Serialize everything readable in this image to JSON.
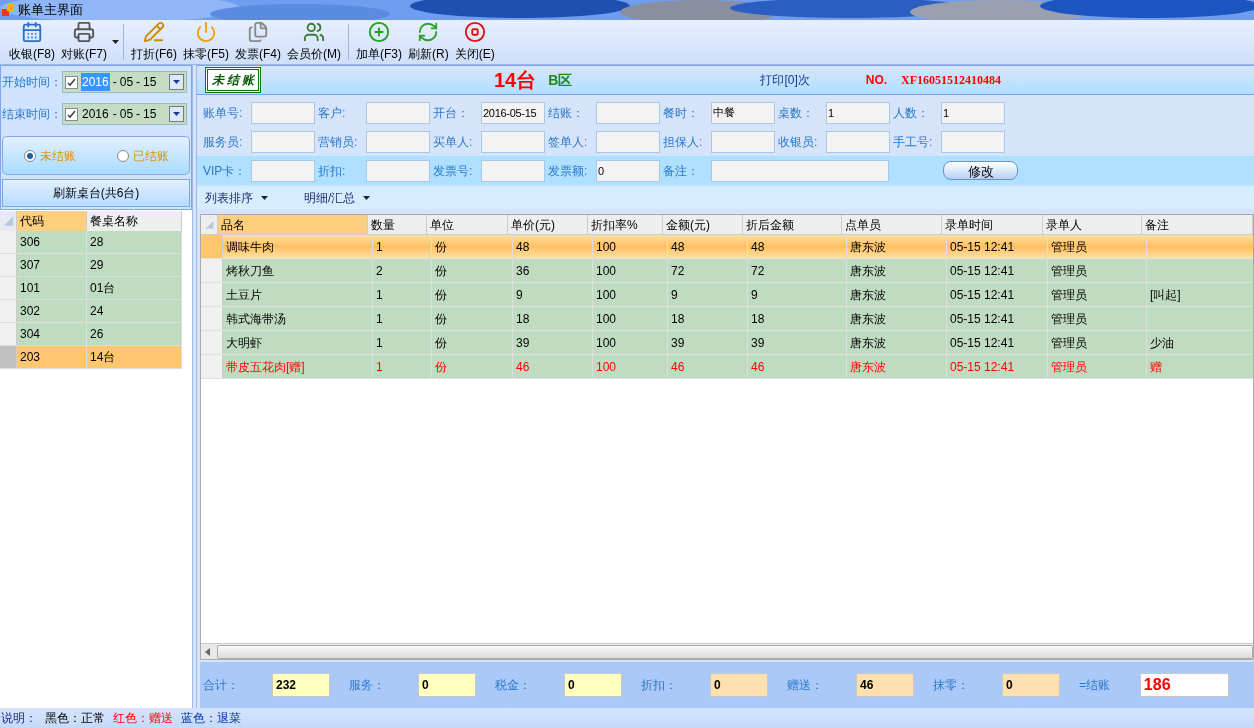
{
  "window": {
    "title": "账单主界面"
  },
  "toolbar": [
    [
      {
        "label": "收银(F8)"
      },
      {
        "label": "对账(F7)",
        "has_menu": true
      }
    ],
    [
      {
        "label": "打折(F6)"
      },
      {
        "label": "抹零(F5)"
      },
      {
        "label": "发票(F4)"
      },
      {
        "label": "会员价(M)"
      }
    ],
    [
      {
        "label": "加单(F3)"
      },
      {
        "label": "刷新(R)"
      },
      {
        "label": "关闭(E)"
      }
    ]
  ],
  "filters": [
    {
      "label": "开始时间：",
      "checked": true,
      "year": "2016",
      "month": "05",
      "day": "15",
      "sep": "-",
      "focused": true
    },
    {
      "label": "结束时间：",
      "checked": true,
      "year": "2016",
      "month": "05",
      "day": "15",
      "sep": "-",
      "focused": false
    }
  ],
  "status_radios": [
    {
      "label": "未结账",
      "selected": true
    },
    {
      "label": "已结账",
      "selected": false
    }
  ],
  "refresh_button": "刷新桌台(共6台)",
  "tables": {
    "columns": [
      "代码",
      "餐桌名称"
    ],
    "rows": [
      {
        "cells": [
          "306",
          "28"
        ],
        "selected": false
      },
      {
        "cells": [
          "307",
          "29"
        ],
        "selected": false
      },
      {
        "cells": [
          "101",
          "01台"
        ],
        "selected": false
      },
      {
        "cells": [
          "302",
          "24"
        ],
        "selected": false
      },
      {
        "cells": [
          "304",
          "26"
        ],
        "selected": false
      },
      {
        "cells": [
          "203",
          "14台"
        ],
        "selected": true
      }
    ]
  },
  "bill_header": {
    "stamp": "未 结 账",
    "table": "14台",
    "area": "B区",
    "print_count": "打印[0]次",
    "no_label": "NO.",
    "bill_no": "XF16051512410484"
  },
  "form_rows": [
    [
      {
        "label": "账单号:"
      },
      {
        "label": "客户:"
      },
      {
        "label": "开台：",
        "value": "2016-05-15"
      },
      {
        "label": "结账："
      },
      {
        "label": "餐时：",
        "value": "中餐"
      },
      {
        "label": "桌数：",
        "value": "1"
      },
      {
        "label": "人数：",
        "value": "1"
      }
    ],
    [
      {
        "label": "服务员:"
      },
      {
        "label": "营销员:"
      },
      {
        "label": "买单人:"
      },
      {
        "label": "签单人:"
      },
      {
        "label": "担保人:"
      },
      {
        "label": "收银员:"
      },
      {
        "label": "手工号:"
      }
    ],
    [
      {
        "label": "VIP卡："
      },
      {
        "label": "折扣:"
      },
      {
        "label": "发票号:"
      },
      {
        "label": "发票额:",
        "value": "0"
      },
      {
        "label": "备注：",
        "wide": true
      }
    ]
  ],
  "edit_button": "修改",
  "menus": [
    {
      "label": "列表排序"
    },
    {
      "label": "明细/汇总"
    }
  ],
  "items": {
    "columns": [
      "品名",
      "数量",
      "单位",
      "单价(元)",
      "折扣率%",
      "金额(元)",
      "折后金额",
      "点单员",
      "录单时间",
      "录单人",
      "备注"
    ],
    "rows": [
      {
        "kind": "normal",
        "selected": true,
        "cells": [
          "调味牛肉",
          "1",
          "份",
          "48",
          "100",
          "48",
          "48",
          "唐东波",
          "05-15 12:41",
          "管理员",
          ""
        ]
      },
      {
        "kind": "normal",
        "selected": false,
        "cells": [
          "烤秋刀鱼",
          "2",
          "份",
          "36",
          "100",
          "72",
          "72",
          "唐东波",
          "05-15 12:41",
          "管理员",
          ""
        ]
      },
      {
        "kind": "normal",
        "selected": false,
        "cells": [
          "土豆片",
          "1",
          "份",
          "9",
          "100",
          "9",
          "9",
          "唐东波",
          "05-15 12:41",
          "管理员",
          "[叫起]"
        ]
      },
      {
        "kind": "normal",
        "selected": false,
        "cells": [
          "韩式海带汤",
          "1",
          "份",
          "18",
          "100",
          "18",
          "18",
          "唐东波",
          "05-15 12:41",
          "管理员",
          ""
        ]
      },
      {
        "kind": "normal",
        "selected": false,
        "cells": [
          "大明虾",
          "1",
          "份",
          "39",
          "100",
          "39",
          "39",
          "唐东波",
          "05-15 12:41",
          "管理员",
          "少油"
        ]
      },
      {
        "kind": "gift",
        "selected": false,
        "cells": [
          "带皮五花肉[赠]",
          "1",
          "份",
          "46",
          "100",
          "46",
          "46",
          "唐东波",
          "05-15 12:41",
          "管理员",
          "赠"
        ]
      }
    ]
  },
  "totals": [
    {
      "label": "合计：",
      "value": "232",
      "kind": "charge"
    },
    {
      "label": "服务：",
      "value": "0",
      "kind": "charge"
    },
    {
      "label": "税金：",
      "value": "0",
      "kind": "charge"
    },
    {
      "label": "折扣：",
      "value": "0",
      "kind": "deduct"
    },
    {
      "label": "赠送：",
      "value": "46",
      "kind": "deduct"
    },
    {
      "label": "抹零：",
      "value": "0",
      "kind": "deduct"
    },
    {
      "label": "=结账",
      "value": "186",
      "kind": "result"
    }
  ],
  "legend": {
    "label": "说明：",
    "items": [
      {
        "text": "黑色：正常",
        "kind": "normal"
      },
      {
        "text": "红色：赠送",
        "kind": "gift"
      },
      {
        "text": "蓝色：退菜",
        "kind": "returned"
      }
    ]
  }
}
